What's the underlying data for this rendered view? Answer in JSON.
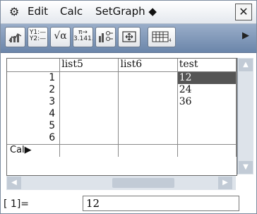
{
  "menubar": {
    "items": [
      "Edit",
      "Calc",
      "SetGraph ◆"
    ],
    "close_label": "✕"
  },
  "toolbar": {
    "buttons": [
      {
        "icon": "stat-graph-icon"
      },
      {
        "line1": "Y1:—",
        "line2": "Y2:—"
      },
      {
        "text": "√α"
      },
      {
        "line1": "π→",
        "line2": "3.141.."
      },
      {
        "icon": "graph-settings-icon"
      },
      {
        "icon": "resize-window-icon"
      },
      {
        "icon": "list-columns-icon"
      },
      {
        "text": "▶"
      }
    ]
  },
  "grid": {
    "headers": [
      "",
      "list5",
      "list6",
      "test"
    ],
    "rows": [
      {
        "num": "1",
        "list5": "",
        "list6": "",
        "test": "12"
      },
      {
        "num": "2",
        "list5": "",
        "list6": "",
        "test": "24"
      },
      {
        "num": "3",
        "list5": "",
        "list6": "",
        "test": "36"
      },
      {
        "num": "4",
        "list5": "",
        "list6": "",
        "test": ""
      },
      {
        "num": "5",
        "list5": "",
        "list6": "",
        "test": ""
      },
      {
        "num": "6",
        "list5": "",
        "list6": "",
        "test": ""
      }
    ],
    "cal_label": "Cal▶"
  },
  "entry": {
    "label": "[   1]=",
    "value": "12"
  }
}
